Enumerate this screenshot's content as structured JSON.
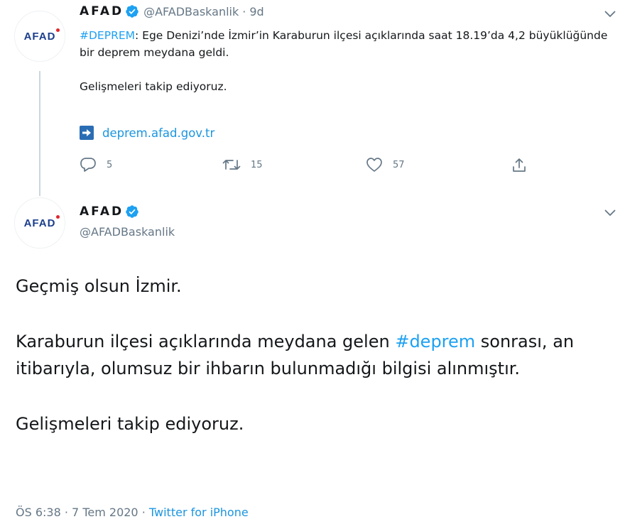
{
  "tweet1": {
    "author_name": "AFAD",
    "author_handle": "@AFADBaskanlik",
    "separator": "·",
    "time_ago": "9d",
    "hashtag": "#DEPREM",
    "text_rest": ": Ege Denizi’nde İzmir’in Karaburun ilçesi açıklarında saat 18.19’da 4,2 büyüklüğünde bir deprem meydana geldi.",
    "text_second": "Gelişmeleri takip ediyoruz.",
    "link": "deprem.afad.gov.tr",
    "replies": "5",
    "retweets": "15",
    "likes": "57"
  },
  "tweet2": {
    "author_name": "AFAD",
    "author_handle": "@AFADBaskanlik",
    "para1": "Geçmiş olsun İzmir.",
    "para2_before": "Karaburun ilçesi açıklarında meydana gelen ",
    "para2_hashtag": "#deprem",
    "para2_after": " sonrası, an itibarıyla, olumsuz bir ihbarın bulunmadığı bilgisi alınmıştır.",
    "para3": "Gelişmeleri takip ediyoruz.",
    "time": "ÖS 6:38",
    "separator": "·",
    "date": "7 Tem 2020",
    "separator2": "·",
    "source": "Twitter for iPhone"
  },
  "avatar_logo": "AFAD",
  "colors": {
    "link": "#1b95e0",
    "hashtag": "#1da1f2",
    "muted": "#657786",
    "verified": "#1da1f2",
    "afad_blue": "#1b3e8c",
    "afad_red": "#e0262f"
  },
  "icons": [
    "verified-badge-icon",
    "chevron-down-icon",
    "link-arrow-icon",
    "reply-icon",
    "retweet-icon",
    "like-icon",
    "share-icon"
  ]
}
